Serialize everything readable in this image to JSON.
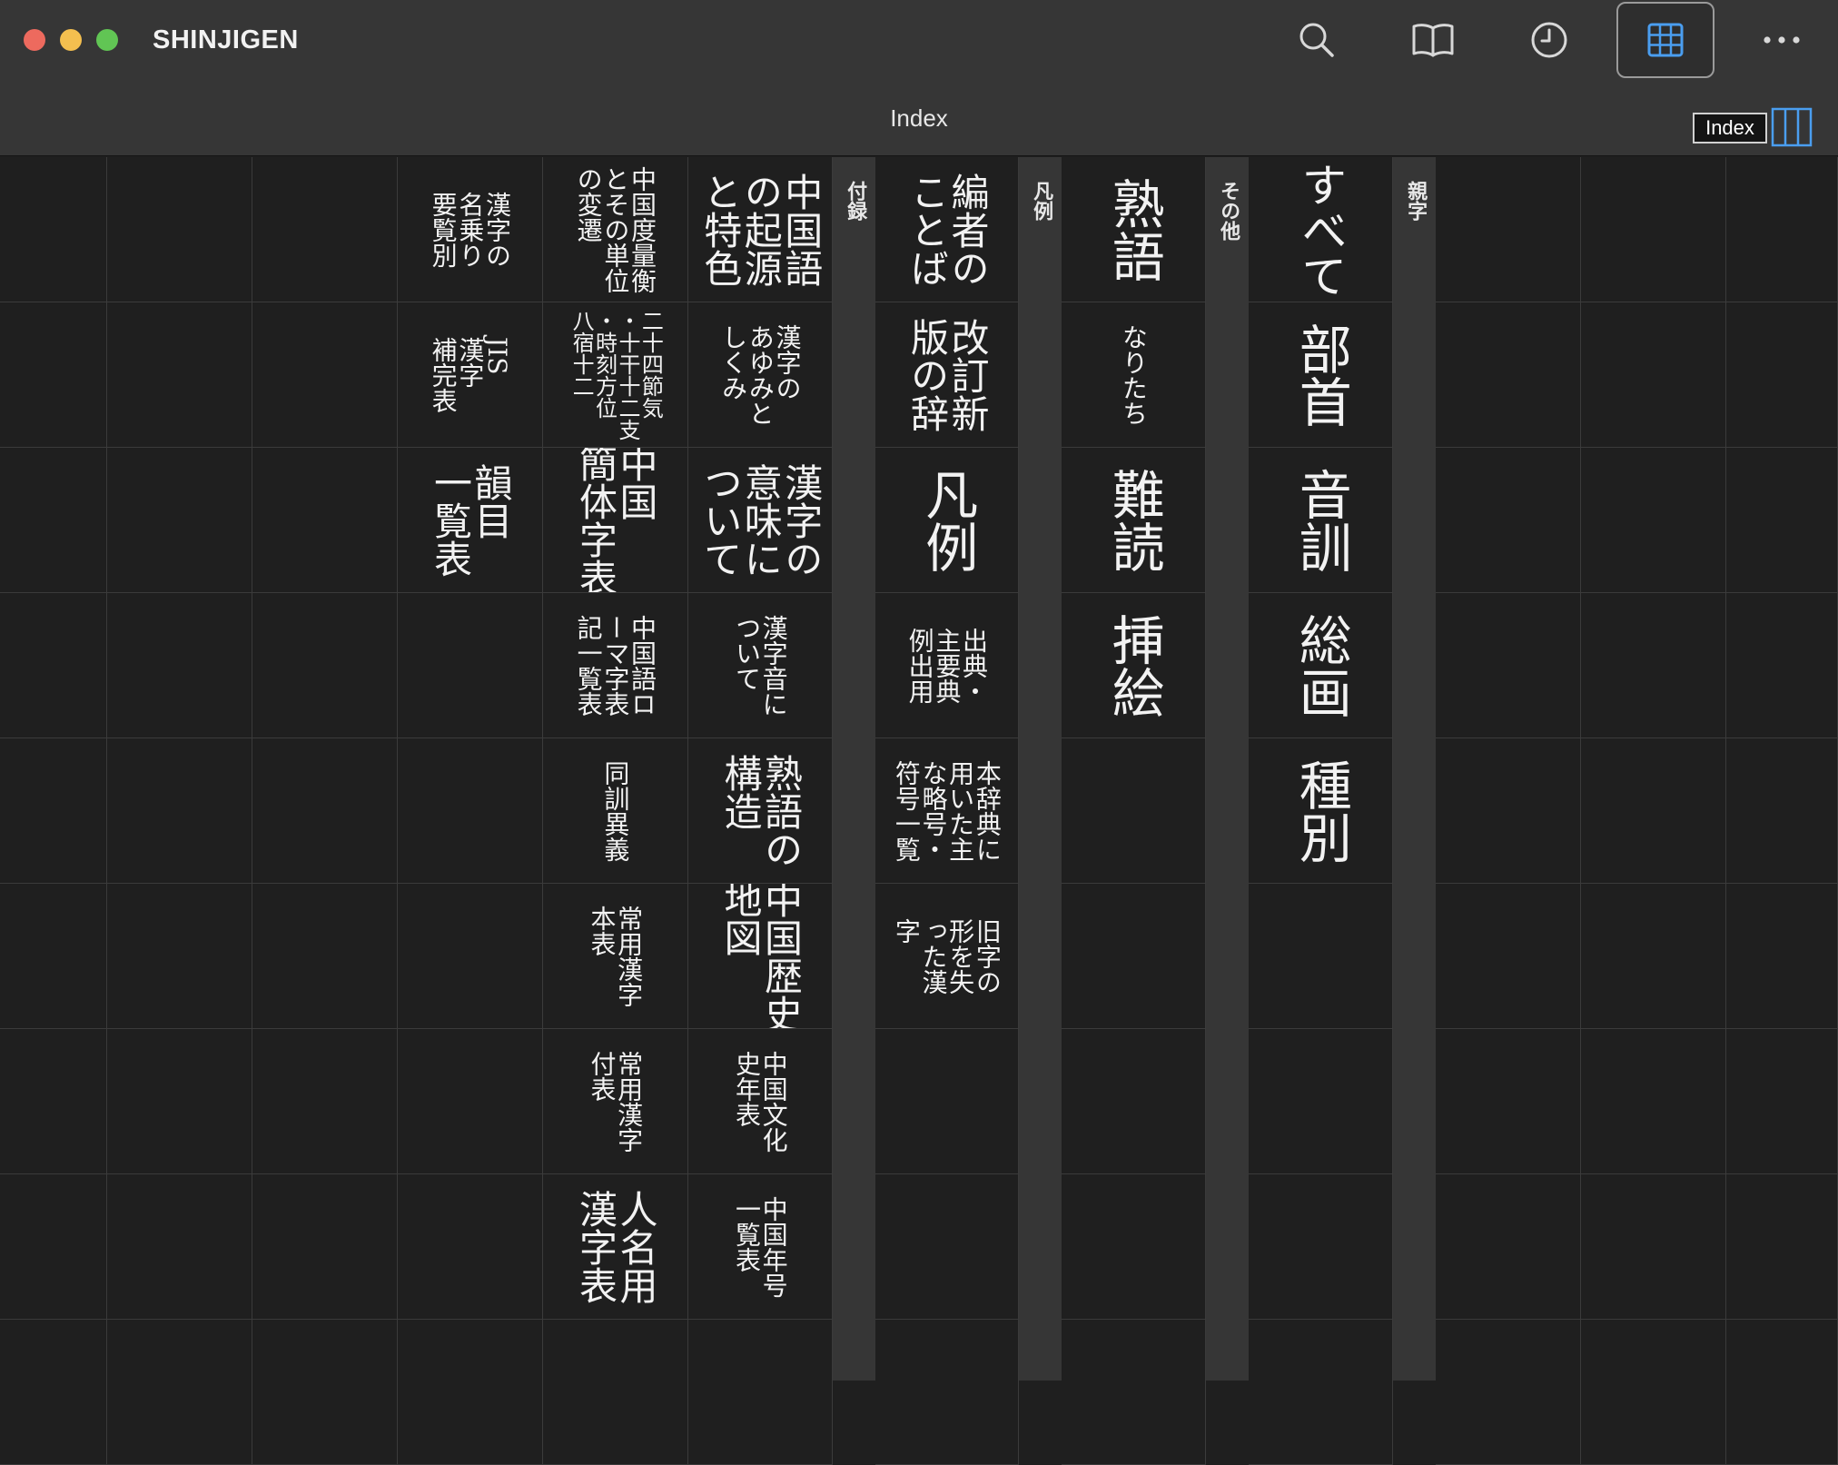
{
  "app": {
    "title": "SHINJIGEN"
  },
  "toolbar": {
    "buttons": [
      {
        "icon": "search-icon",
        "active": false
      },
      {
        "icon": "book-icon",
        "active": false
      },
      {
        "icon": "history-icon",
        "active": false
      },
      {
        "icon": "grid-icon",
        "active": true
      },
      {
        "icon": "more-icon",
        "active": false
      }
    ]
  },
  "subbar": {
    "title": "Index",
    "badge": "Index"
  },
  "sections": [
    {
      "label": "付録"
    },
    {
      "label": "凡例"
    },
    {
      "label": "その他"
    },
    {
      "label": "親字"
    }
  ],
  "appendix": {
    "col1": [
      "漢字の\n名乗り\n要覧別",
      "JIS\n漢字\n補完表",
      "韻目\n一覧表"
    ],
    "col2": [
      "中国度量衡\nとその単位\nの変遷",
      "二十四節気\n・十干十二支\n・時刻方位\n八宿十二",
      "中国\n簡体字表",
      "中国語ロ\nーマ字表\n記一覧表",
      "同訓異義",
      "常用漢字\n本表",
      "常用漢字\n付表",
      "人名用\n漢字表"
    ],
    "col3": [
      "中国語\nの起源\nと特色",
      "漢字の\nあゆみと\nしくみ",
      "漢字の\n意味に\nついて",
      "漢字音に\nついて",
      "熟語の\n構造",
      "中国歴史\n地図",
      "中国文化\n史年表",
      "中国年号\n一覧表"
    ]
  },
  "notes": [
    "編者の\nことば",
    "改訂新\n版の辞",
    "凡例",
    "出典・\n主要典\n例出用",
    "本辞典に\n用いた主\nな略号・\n符号一覧",
    "旧字の\n形を失\nった漢\n字"
  ],
  "other": [
    "熟語",
    "なりたち",
    "難読",
    "挿絵"
  ],
  "kanji": [
    "すべて",
    "部首",
    "音訓",
    "総画",
    "種別"
  ]
}
